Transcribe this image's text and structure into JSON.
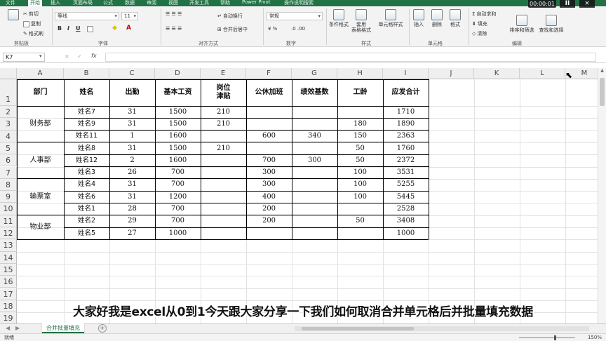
{
  "ribbon_tabs": [
    "文件",
    "开始",
    "插入",
    "页面布局",
    "公式",
    "数据",
    "审阅",
    "视图",
    "开发工具",
    "帮助",
    "Power Pivot",
    "操作说明搜索"
  ],
  "ribbon_tabs_active_index": 1,
  "clipboard": {
    "cut": "剪切",
    "copy": "复制",
    "format_painter": "格式刷",
    "label": "剪贴板"
  },
  "font": {
    "name": "等线",
    "size": "11",
    "label": "字体",
    "bold": "B",
    "italic": "I",
    "underline": "U"
  },
  "alignment": {
    "wrap": "自动换行",
    "merge": "合并后居中",
    "label": "对齐方式"
  },
  "number": {
    "format": "常规",
    "label": "数字"
  },
  "styles": {
    "cond": "条件格式",
    "table": "套用\n表格格式",
    "cell": "单元格样式",
    "label": "样式"
  },
  "cells": {
    "insert": "插入",
    "delete": "删除",
    "format": "格式",
    "label": "单元格"
  },
  "editing": {
    "autosum": "自动求和",
    "fill": "填充",
    "clear": "清除",
    "sort": "排序和筛选",
    "find": "查找和选择",
    "label": "编辑"
  },
  "video": {
    "time": "00:00:01",
    "pause": "II",
    "close": "×"
  },
  "formula_bar": {
    "name_box": "K7",
    "fx": "fx",
    "cancel": "×",
    "enter": "✓",
    "value": ""
  },
  "columns": [
    "A",
    "B",
    "C",
    "D",
    "E",
    "F",
    "G",
    "H",
    "I",
    "J",
    "K",
    "L",
    "M"
  ],
  "rows": [
    "1",
    "2",
    "3",
    "4",
    "5",
    "6",
    "7",
    "8",
    "9",
    "10",
    "11",
    "12",
    "13",
    "14",
    "15",
    "16",
    "17",
    "18",
    "19"
  ],
  "table": {
    "headers": [
      "部门",
      "姓名",
      "出勤",
      "基本工资",
      "岗位\n津贴",
      "公休加班",
      "绩效基数",
      "工龄",
      "应发合计"
    ],
    "departments": [
      "财务部",
      "人事部",
      "输票室",
      "物业部"
    ],
    "rows": [
      [
        "姓名7",
        "31",
        "1500",
        "210",
        "",
        "",
        "",
        "1710"
      ],
      [
        "姓名9",
        "31",
        "1500",
        "210",
        "",
        "",
        "180",
        "1890"
      ],
      [
        "姓名11",
        "1",
        "1600",
        "",
        "600",
        "340",
        "150",
        "2363"
      ],
      [
        "姓名8",
        "31",
        "1500",
        "210",
        "",
        "",
        "50",
        "1760"
      ],
      [
        "姓名12",
        "2",
        "1600",
        "",
        "700",
        "300",
        "50",
        "2372"
      ],
      [
        "姓名3",
        "26",
        "700",
        "",
        "300",
        "",
        "100",
        "3531"
      ],
      [
        "姓名4",
        "31",
        "700",
        "",
        "300",
        "",
        "100",
        "5255"
      ],
      [
        "姓名6",
        "31",
        "1200",
        "",
        "400",
        "",
        "100",
        "5445"
      ],
      [
        "姓名1",
        "28",
        "700",
        "",
        "200",
        "",
        "",
        "2528"
      ],
      [
        "姓名2",
        "29",
        "700",
        "",
        "200",
        "",
        "50",
        "3408"
      ],
      [
        "姓名5",
        "27",
        "1000",
        "",
        "",
        "",
        "",
        "1000"
      ]
    ]
  },
  "subtitle": "大家好我是excel从0到1今天跟大家分享一下我们如何取消合并单元格后并批量填充数据",
  "sheet_tab": "合并批量填充",
  "status": {
    "ready": "就绪",
    "zoom": "150%"
  }
}
